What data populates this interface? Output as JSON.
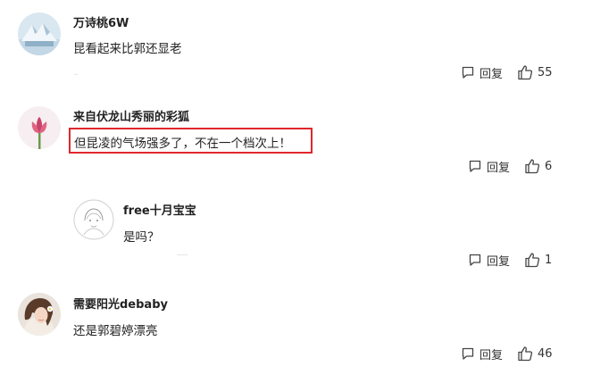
{
  "comments": [
    {
      "username": "万诗桃6W",
      "text": "昆看起来比郭还显老",
      "reply_label": "回复",
      "likes": "55",
      "avatar_icon": "mountain-snow-icon"
    },
    {
      "username": "来自伏龙山秀丽的彩狐",
      "text": "但昆凌的气场强多了，不在一个档次上！",
      "reply_label": "回复",
      "likes": "6",
      "avatar_icon": "pink-tulip-icon",
      "highlight_color": "#e0272c"
    },
    {
      "username": "free十月宝宝",
      "text": "是吗？",
      "reply_label": "回复",
      "likes": "1",
      "avatar_icon": "sketch-girl-icon"
    },
    {
      "username": "需要阳光debaby",
      "text": "还是郭碧婷漂亮",
      "reply_label": "回复",
      "likes": "46",
      "avatar_icon": "woman-portrait-icon"
    }
  ]
}
